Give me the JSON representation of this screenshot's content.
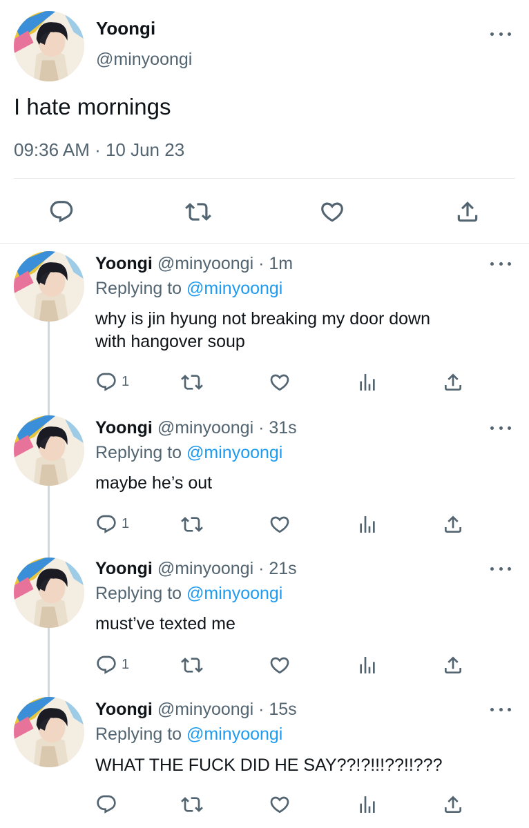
{
  "main_tweet": {
    "display_name": "Yoongi",
    "handle": "@minyoongi",
    "text": "I hate mornings",
    "timestamp": "09:36 AM · 10 Jun 23"
  },
  "replies": [
    {
      "display_name": "Yoongi",
      "handle_time": "@minyoongi · 1m",
      "replying_prefix": "Replying to",
      "replying_to": "@minyoongi",
      "text_lines": [
        "why is jin hyung not breaking my door down",
        "with hangover soup"
      ],
      "reply_count": "1"
    },
    {
      "display_name": "Yoongi",
      "handle_time": "@minyoongi · 31s",
      "replying_prefix": "Replying to",
      "replying_to": "@minyoongi",
      "text_lines": [
        "maybe he’s out"
      ],
      "reply_count": "1"
    },
    {
      "display_name": "Yoongi",
      "handle_time": "@minyoongi · 21s",
      "replying_prefix": "Replying to",
      "replying_to": "@minyoongi",
      "text_lines": [
        "must’ve texted me"
      ],
      "reply_count": "1"
    },
    {
      "display_name": "Yoongi",
      "handle_time": "@minyoongi · 15s",
      "replying_prefix": "Replying to",
      "replying_to": "@minyoongi",
      "text_lines": [
        "WHAT THE FUCK DID HE SAY??!?!!!??!!???"
      ],
      "reply_count": ""
    }
  ],
  "colors": {
    "text": "#0f1419",
    "muted": "#536471",
    "link": "#1d9bf0",
    "divider": "#e6e9eb",
    "thread_line": "#cfd9de"
  },
  "icons": [
    "reply-icon",
    "retweet-icon",
    "like-icon",
    "views-icon",
    "share-icon",
    "more-icon"
  ]
}
